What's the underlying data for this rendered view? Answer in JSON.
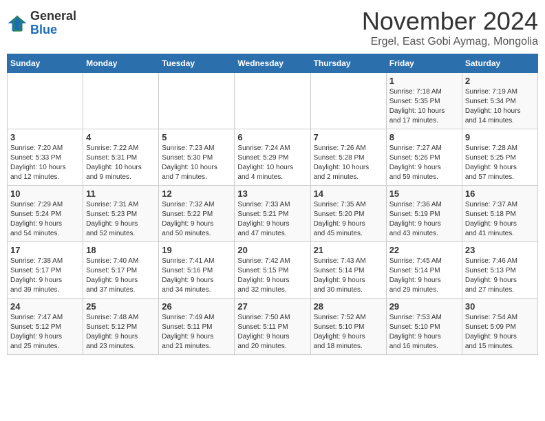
{
  "logo": {
    "general": "General",
    "blue": "Blue"
  },
  "title": "November 2024",
  "location": "Ergel, East Gobi Aymag, Mongolia",
  "days_of_week": [
    "Sunday",
    "Monday",
    "Tuesday",
    "Wednesday",
    "Thursday",
    "Friday",
    "Saturday"
  ],
  "weeks": [
    [
      {
        "day": "",
        "info": ""
      },
      {
        "day": "",
        "info": ""
      },
      {
        "day": "",
        "info": ""
      },
      {
        "day": "",
        "info": ""
      },
      {
        "day": "",
        "info": ""
      },
      {
        "day": "1",
        "info": "Sunrise: 7:18 AM\nSunset: 5:35 PM\nDaylight: 10 hours\nand 17 minutes."
      },
      {
        "day": "2",
        "info": "Sunrise: 7:19 AM\nSunset: 5:34 PM\nDaylight: 10 hours\nand 14 minutes."
      }
    ],
    [
      {
        "day": "3",
        "info": "Sunrise: 7:20 AM\nSunset: 5:33 PM\nDaylight: 10 hours\nand 12 minutes."
      },
      {
        "day": "4",
        "info": "Sunrise: 7:22 AM\nSunset: 5:31 PM\nDaylight: 10 hours\nand 9 minutes."
      },
      {
        "day": "5",
        "info": "Sunrise: 7:23 AM\nSunset: 5:30 PM\nDaylight: 10 hours\nand 7 minutes."
      },
      {
        "day": "6",
        "info": "Sunrise: 7:24 AM\nSunset: 5:29 PM\nDaylight: 10 hours\nand 4 minutes."
      },
      {
        "day": "7",
        "info": "Sunrise: 7:26 AM\nSunset: 5:28 PM\nDaylight: 10 hours\nand 2 minutes."
      },
      {
        "day": "8",
        "info": "Sunrise: 7:27 AM\nSunset: 5:26 PM\nDaylight: 9 hours\nand 59 minutes."
      },
      {
        "day": "9",
        "info": "Sunrise: 7:28 AM\nSunset: 5:25 PM\nDaylight: 9 hours\nand 57 minutes."
      }
    ],
    [
      {
        "day": "10",
        "info": "Sunrise: 7:29 AM\nSunset: 5:24 PM\nDaylight: 9 hours\nand 54 minutes."
      },
      {
        "day": "11",
        "info": "Sunrise: 7:31 AM\nSunset: 5:23 PM\nDaylight: 9 hours\nand 52 minutes."
      },
      {
        "day": "12",
        "info": "Sunrise: 7:32 AM\nSunset: 5:22 PM\nDaylight: 9 hours\nand 50 minutes."
      },
      {
        "day": "13",
        "info": "Sunrise: 7:33 AM\nSunset: 5:21 PM\nDaylight: 9 hours\nand 47 minutes."
      },
      {
        "day": "14",
        "info": "Sunrise: 7:35 AM\nSunset: 5:20 PM\nDaylight: 9 hours\nand 45 minutes."
      },
      {
        "day": "15",
        "info": "Sunrise: 7:36 AM\nSunset: 5:19 PM\nDaylight: 9 hours\nand 43 minutes."
      },
      {
        "day": "16",
        "info": "Sunrise: 7:37 AM\nSunset: 5:18 PM\nDaylight: 9 hours\nand 41 minutes."
      }
    ],
    [
      {
        "day": "17",
        "info": "Sunrise: 7:38 AM\nSunset: 5:17 PM\nDaylight: 9 hours\nand 39 minutes."
      },
      {
        "day": "18",
        "info": "Sunrise: 7:40 AM\nSunset: 5:17 PM\nDaylight: 9 hours\nand 37 minutes."
      },
      {
        "day": "19",
        "info": "Sunrise: 7:41 AM\nSunset: 5:16 PM\nDaylight: 9 hours\nand 34 minutes."
      },
      {
        "day": "20",
        "info": "Sunrise: 7:42 AM\nSunset: 5:15 PM\nDaylight: 9 hours\nand 32 minutes."
      },
      {
        "day": "21",
        "info": "Sunrise: 7:43 AM\nSunset: 5:14 PM\nDaylight: 9 hours\nand 30 minutes."
      },
      {
        "day": "22",
        "info": "Sunrise: 7:45 AM\nSunset: 5:14 PM\nDaylight: 9 hours\nand 29 minutes."
      },
      {
        "day": "23",
        "info": "Sunrise: 7:46 AM\nSunset: 5:13 PM\nDaylight: 9 hours\nand 27 minutes."
      }
    ],
    [
      {
        "day": "24",
        "info": "Sunrise: 7:47 AM\nSunset: 5:12 PM\nDaylight: 9 hours\nand 25 minutes."
      },
      {
        "day": "25",
        "info": "Sunrise: 7:48 AM\nSunset: 5:12 PM\nDaylight: 9 hours\nand 23 minutes."
      },
      {
        "day": "26",
        "info": "Sunrise: 7:49 AM\nSunset: 5:11 PM\nDaylight: 9 hours\nand 21 minutes."
      },
      {
        "day": "27",
        "info": "Sunrise: 7:50 AM\nSunset: 5:11 PM\nDaylight: 9 hours\nand 20 minutes."
      },
      {
        "day": "28",
        "info": "Sunrise: 7:52 AM\nSunset: 5:10 PM\nDaylight: 9 hours\nand 18 minutes."
      },
      {
        "day": "29",
        "info": "Sunrise: 7:53 AM\nSunset: 5:10 PM\nDaylight: 9 hours\nand 16 minutes."
      },
      {
        "day": "30",
        "info": "Sunrise: 7:54 AM\nSunset: 5:09 PM\nDaylight: 9 hours\nand 15 minutes."
      }
    ]
  ]
}
